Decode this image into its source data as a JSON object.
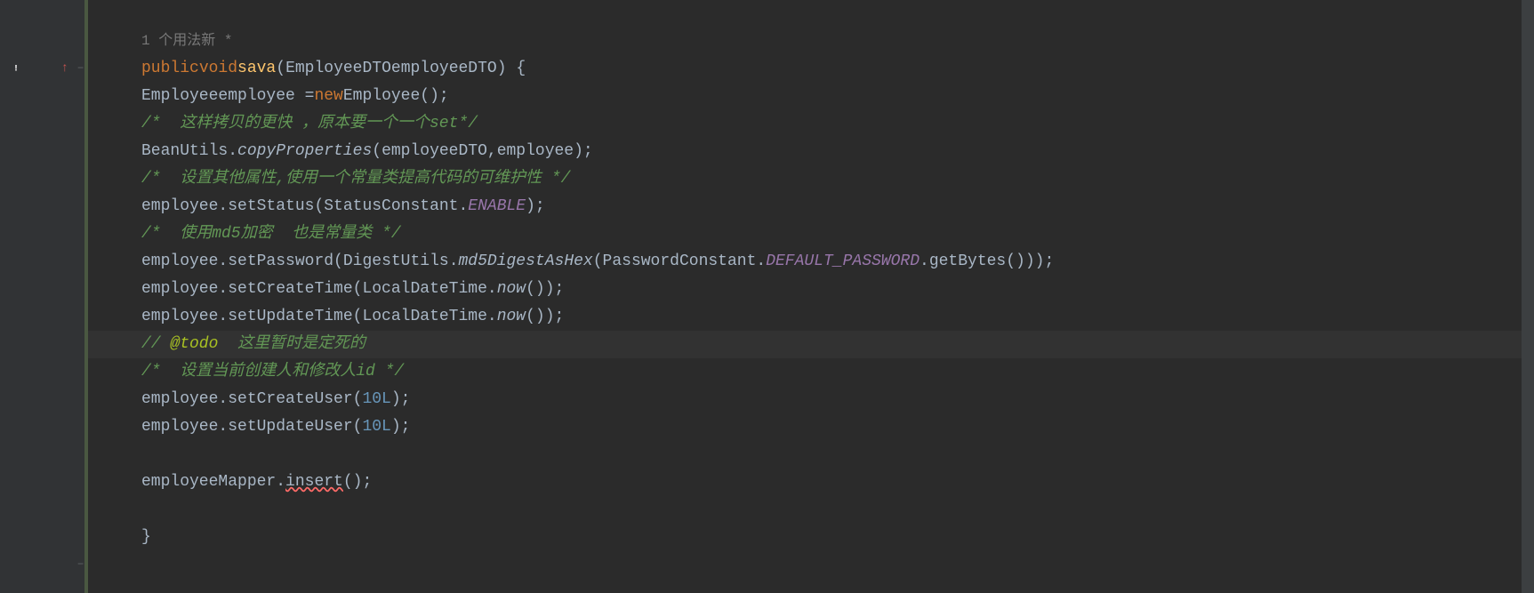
{
  "gutter": {
    "start_markers": {
      "warning": true,
      "arrow": "↑"
    },
    "fold_open": "−",
    "fold_close": "−"
  },
  "hint": {
    "usages": "1 个用法",
    "new_marker": "新 *"
  },
  "code": {
    "line1": {
      "kw_public": "public",
      "kw_void": "void",
      "method": "sava",
      "param_type": "EmployeeDTO",
      "param_name": "employeeDTO",
      "brace": ") {"
    },
    "line2": {
      "type": "Employee",
      "var": "employee",
      "eq": " =",
      "kw_new": "new",
      "ctor": "Employee",
      "end": "();"
    },
    "line3": {
      "comment": "/*  这样拷贝的更快 ，原本要一个一个set*/"
    },
    "line4": {
      "cls": "BeanUtils",
      "dot": ".",
      "method": "copyProperties",
      "args": "(employeeDTO,employee);"
    },
    "line5": {
      "comment": "/*  设置其他属性,使用一个常量类提高代码的可维护性 */"
    },
    "line6": {
      "obj": "employee",
      "method": ".setStatus(",
      "cls": "StatusConstant",
      "dot": ".",
      "constant": "ENABLE",
      "end": ");"
    },
    "line7": {
      "comment": "/*  使用md5加密  也是常量类 */"
    },
    "line8": {
      "obj": "employee",
      "m1": ".setPassword(",
      "cls1": "DigestUtils",
      "dot1": ".",
      "static_m": "md5DigestAsHex",
      "open": "(",
      "cls2": "PasswordConstant",
      "dot2": ".",
      "constant": "DEFAULT_PASSWORD",
      "m2": ".getBytes()));"
    },
    "line9": {
      "obj": "employee",
      "m1": ".setCreateTime(",
      "cls": "LocalDateTime",
      "dot": ".",
      "static_m": "now",
      "end": "());"
    },
    "line10": {
      "obj": "employee",
      "m1": ".setUpdateTime(",
      "cls": "LocalDateTime",
      "dot": ".",
      "static_m": "now",
      "end": "());"
    },
    "line11": {
      "slashes": "// ",
      "todo": "@todo",
      "rest": "  这里暂时是定死的"
    },
    "line12": {
      "comment": "/*  设置当前创建人和修改人id */"
    },
    "line13": {
      "obj": "employee",
      "m1": ".setCreateUser(",
      "num": "10L",
      "end": ");"
    },
    "line14": {
      "obj": "employee",
      "m1": ".setUpdateUser(",
      "num": "10L",
      "end": ");"
    },
    "line15": {
      "obj": "employeeMapper",
      "m1": ".",
      "method_err": "insert",
      "end": "();"
    },
    "line16": {
      "brace": "}"
    }
  }
}
